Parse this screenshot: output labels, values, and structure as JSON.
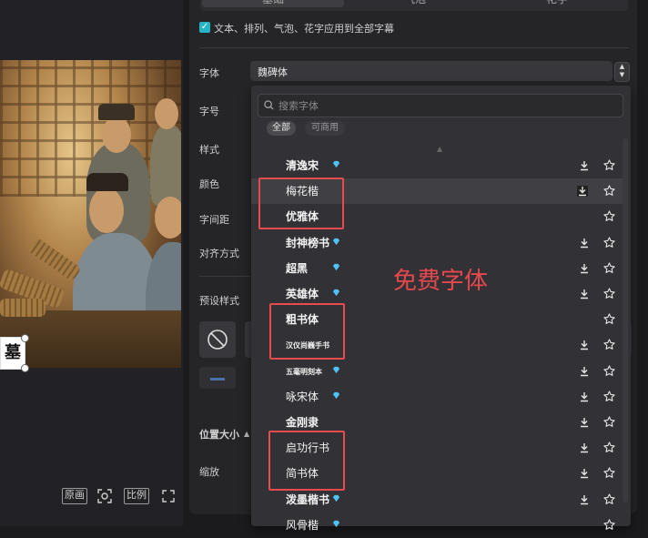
{
  "tabs": [
    "基础",
    "气泡",
    "花字"
  ],
  "apply_all": {
    "checked": true,
    "label": "文本、排列、气泡、花字应用到全部字幕"
  },
  "fields": {
    "font": "字体",
    "size": "字号",
    "style": "样式",
    "color": "颜色",
    "spacing": "字间距",
    "align": "对齐方式",
    "preset": "预设样式",
    "position_size": "位置大小",
    "scale": "缩放"
  },
  "font_select": {
    "value": "魏碑体"
  },
  "dropdown": {
    "search_placeholder": "搜索字体",
    "filters": [
      {
        "label": "全部",
        "active": true
      },
      {
        "label": "可商用",
        "active": false
      }
    ],
    "fonts": [
      {
        "name": "清逸宋",
        "vip": true,
        "download": true,
        "style": "bold"
      },
      {
        "name": "梅花楷",
        "vip": false,
        "download": true,
        "style": "thin",
        "highlighted": true
      },
      {
        "name": "优雅体",
        "vip": false,
        "download": false,
        "style": "bold"
      },
      {
        "name": "封神榜书",
        "vip": true,
        "download": true,
        "style": "bold"
      },
      {
        "name": "超黑",
        "vip": true,
        "download": true,
        "style": "bold"
      },
      {
        "name": "英雄体",
        "vip": true,
        "download": true,
        "style": "bold"
      },
      {
        "name": "粗书体",
        "vip": false,
        "download": false,
        "style": "bold"
      },
      {
        "name": "汉仪尚巍手书",
        "vip": false,
        "download": true,
        "style": "tiny"
      },
      {
        "name": "五毫明刻本",
        "vip": true,
        "download": true,
        "style": "tiny"
      },
      {
        "name": "咏宋体",
        "vip": true,
        "download": true,
        "style": "thin"
      },
      {
        "name": "金刚隶",
        "vip": false,
        "download": true,
        "style": "bold"
      },
      {
        "name": "启功行书",
        "vip": false,
        "download": true,
        "style": "thin"
      },
      {
        "name": "简书体",
        "vip": false,
        "download": true,
        "style": "thin"
      },
      {
        "name": "泼墨楷书",
        "vip": true,
        "download": true,
        "style": "bold"
      },
      {
        "name": "风骨楷",
        "vip": true,
        "download": false,
        "style": "thin"
      }
    ]
  },
  "annotation": "免费字体",
  "preview": {
    "caption_char": "墓"
  },
  "bottom_bar": {
    "original": "原画",
    "ratio": "比例"
  },
  "icons": {
    "search": "search-icon",
    "diamond": "diamond-icon",
    "download": "download-icon",
    "star": "star-icon",
    "fullscreen": "fullscreen-icon",
    "screenshot": "screenshot-icon",
    "none": "ban-icon"
  },
  "colors": {
    "accent": "#24b6c7",
    "annotation": "#e5484d",
    "vip": "#4fc3f7"
  }
}
